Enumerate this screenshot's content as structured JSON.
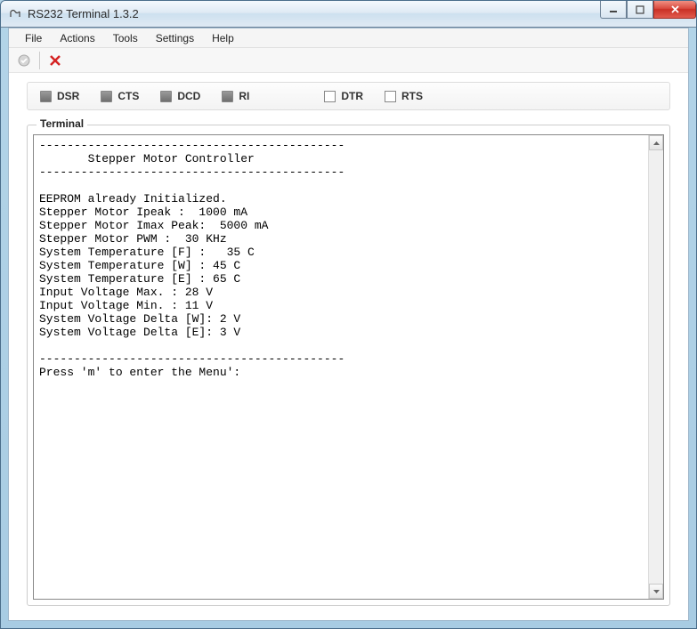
{
  "window": {
    "title": "RS232 Terminal 1.3.2"
  },
  "menubar": {
    "file": "File",
    "actions": "Actions",
    "tools": "Tools",
    "settings": "Settings",
    "help": "Help"
  },
  "status": {
    "dsr": "DSR",
    "cts": "CTS",
    "dcd": "DCD",
    "ri": "RI",
    "dtr": "DTR",
    "rts": "RTS"
  },
  "terminal": {
    "legend": "Terminal",
    "output": "--------------------------------------------\n       Stepper Motor Controller\n--------------------------------------------\n\nEEPROM already Initialized.\nStepper Motor Ipeak :  1000 mA\nStepper Motor Imax Peak:  5000 mA\nStepper Motor PWM :  30 KHz\nSystem Temperature [F] :   35 C\nSystem Temperature [W] : 45 C\nSystem Temperature [E] : 65 C\nInput Voltage Max. : 28 V\nInput Voltage Min. : 11 V\nSystem Voltage Delta [W]: 2 V\nSystem Voltage Delta [E]: 3 V\n\n--------------------------------------------\nPress 'm' to enter the Menu':"
  }
}
